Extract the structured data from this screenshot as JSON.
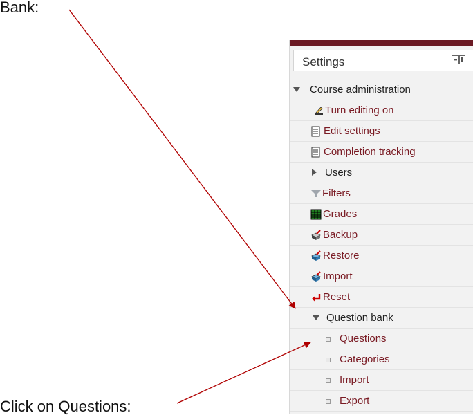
{
  "callouts": {
    "top": "Bank:",
    "bottom": "Click on Questions:"
  },
  "settings": {
    "title": "Settings",
    "dock_icon": "dock-toggle-icon"
  },
  "tree": {
    "course_admin": "Course administration",
    "items": [
      {
        "label": "Turn editing on",
        "icon": "pencil-edit-icon"
      },
      {
        "label": "Edit settings",
        "icon": "document-icon"
      },
      {
        "label": "Completion tracking",
        "icon": "document-icon"
      },
      {
        "label": "Users",
        "icon": "expand-arrow-icon"
      },
      {
        "label": "Filters",
        "icon": "filter-icon"
      },
      {
        "label": "Grades",
        "icon": "grades-table-icon"
      },
      {
        "label": "Backup",
        "icon": "backup-box-icon"
      },
      {
        "label": "Restore",
        "icon": "restore-box-icon"
      },
      {
        "label": "Import",
        "icon": "import-box-icon"
      },
      {
        "label": "Reset",
        "icon": "reset-arrow-icon"
      }
    ],
    "question_bank": "Question bank",
    "question_bank_items": [
      "Questions",
      "Categories",
      "Import",
      "Export"
    ]
  },
  "colors": {
    "link": "#7a1b24",
    "panel_bar": "#6b1a24",
    "arrow": "#b00000"
  }
}
